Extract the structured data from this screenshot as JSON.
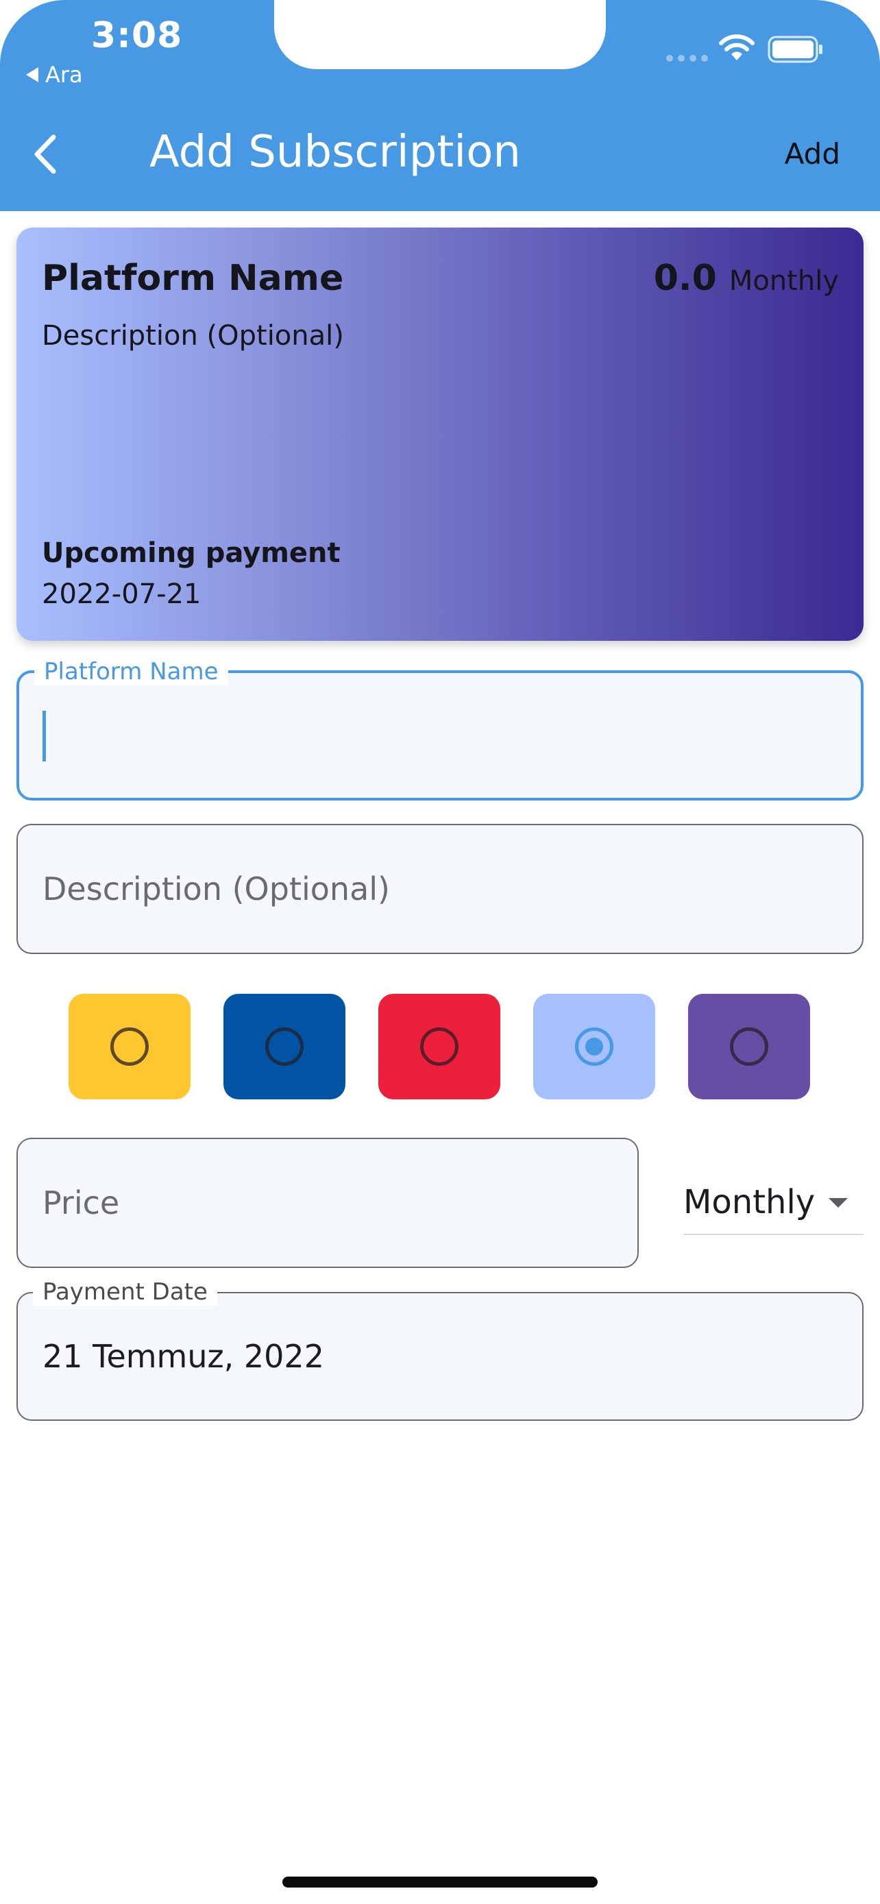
{
  "status_bar": {
    "time": "3:08",
    "back_app_label": "Ara"
  },
  "app_bar": {
    "title": "Add Subscription",
    "action_label": "Add",
    "background_color": "#4799e3"
  },
  "preview_card": {
    "name": "Platform Name",
    "price": "0.0",
    "period": "Monthly",
    "description": "Description (Optional)",
    "upcoming_label": "Upcoming payment",
    "upcoming_date": "2022-07-21"
  },
  "form": {
    "platform_name": {
      "label": "Platform Name",
      "value": ""
    },
    "description": {
      "placeholder": "Description (Optional)",
      "value": ""
    },
    "price": {
      "placeholder": "Price",
      "value": ""
    },
    "period_select": {
      "selected": "Monthly"
    },
    "payment_date": {
      "label": "Payment Date",
      "value": "21 Temmuz, 2022"
    }
  },
  "color_options": [
    {
      "name": "yellow",
      "color": "#ffc72f",
      "selected": false
    },
    {
      "name": "dark-blue",
      "color": "#0054a3",
      "selected": false
    },
    {
      "name": "red",
      "color": "#ed1f3b",
      "selected": false
    },
    {
      "name": "light-blue",
      "color": "#a5bfff",
      "selected": true
    },
    {
      "name": "purple",
      "color": "#654ea3",
      "selected": false
    }
  ]
}
